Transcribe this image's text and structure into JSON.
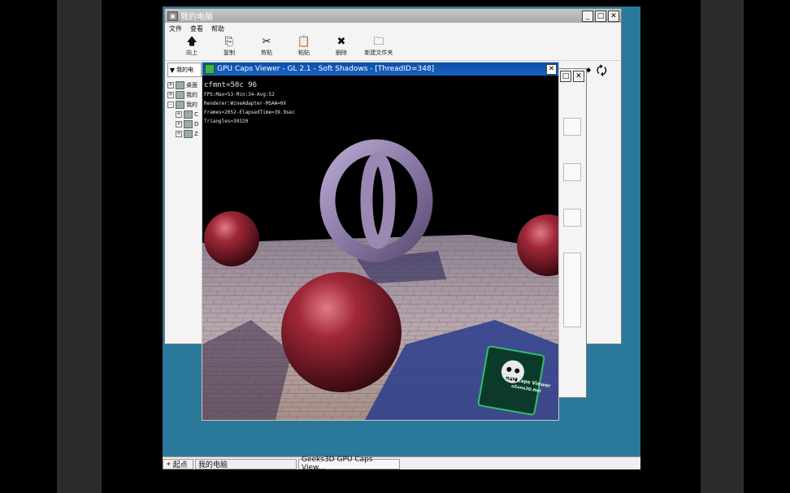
{
  "explorer": {
    "title": "我的电脑",
    "menu": [
      "文件",
      "查看",
      "帮助"
    ],
    "toolbar": [
      {
        "icon": "arrow-up-icon",
        "glyph": "🡅",
        "label": "向上"
      },
      {
        "icon": "copy-icon",
        "glyph": "⎘",
        "label": "复制"
      },
      {
        "icon": "cut-icon",
        "glyph": "✂",
        "label": "剪贴"
      },
      {
        "icon": "paste-icon",
        "glyph": "📋",
        "label": "粘贴"
      },
      {
        "icon": "delete-icon",
        "glyph": "✖",
        "label": "删除"
      },
      {
        "icon": "new-folder-icon",
        "glyph": "🗀",
        "label": "新建文件夹"
      }
    ],
    "address_value": "我的电",
    "tree": [
      {
        "expander": "+",
        "label": "桌面"
      },
      {
        "expander": "+",
        "label": "我的"
      },
      {
        "expander": "-",
        "label": "我的"
      },
      {
        "expander": "+",
        "label": "C",
        "child": true
      },
      {
        "expander": "+",
        "label": "D",
        "child": true
      },
      {
        "expander": "+",
        "label": "Z",
        "child": true
      }
    ],
    "nav_forward_glyph": "➡",
    "nav_refresh_glyph": "🗘"
  },
  "gpu_window": {
    "title": "GPU Caps Viewer - GL 2.1 - Soft Shadows - [ThreadID=348]",
    "close_glyph": "✕",
    "hud": {
      "line1": "cfmnt=50c 96",
      "line2": "FPS:Max=53-Min:34-Avg:52",
      "line3": "Renderer:WineAdapter-MSAA=0X",
      "line4": "Frames=2052-ElapsedTime=39.9sec",
      "line5": "Triangles=39320"
    },
    "logo_text": "GPU Caps Viewer",
    "logo_subtext": "oZone3D.Net"
  },
  "taskbar": {
    "start_label": "起点",
    "task1": "我的电脑",
    "task2": "Geeks3D GPU Caps View..."
  },
  "colors": {
    "desktop": "#2a789a",
    "gpu_titlebar": "#0a4ea8",
    "floor_light": "#b9a7ae",
    "floor_shadow": "#2a3c8c",
    "sphere": "#8a1f2a",
    "torus": "#9a88b2"
  }
}
